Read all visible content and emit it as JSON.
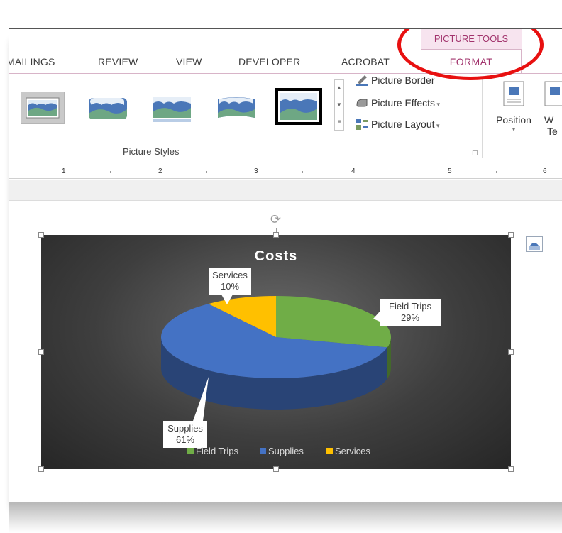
{
  "ribbon": {
    "tabs": [
      "MAILINGS",
      "REVIEW",
      "VIEW",
      "DEVELOPER",
      "ACROBAT"
    ],
    "context_header": "PICTURE TOOLS",
    "active_tab": "FORMAT",
    "commands": {
      "picture_border": "Picture Border",
      "picture_effects": "Picture Effects",
      "picture_layout": "Picture Layout"
    },
    "group_label": "Picture Styles",
    "position_label": "Position",
    "wrap_label_1": "W",
    "wrap_label_2": "Te"
  },
  "ruler": {
    "numbers": [
      "1",
      "2",
      "3",
      "4",
      "5",
      "6"
    ]
  },
  "colors": {
    "accent": "#a2346d",
    "highlight": "#e81010",
    "field_trips": "#70ad47",
    "supplies": "#4472c4",
    "services": "#ffc000"
  },
  "chart_data": {
    "type": "pie",
    "title": "Costs",
    "categories": [
      "Field Trips",
      "Supplies",
      "Services"
    ],
    "values": [
      29,
      61,
      10
    ],
    "labels": [
      "Field Trips\n29%",
      "Supplies\n61%",
      "Services\n10%"
    ],
    "legend": "bottom",
    "style": "3d"
  }
}
